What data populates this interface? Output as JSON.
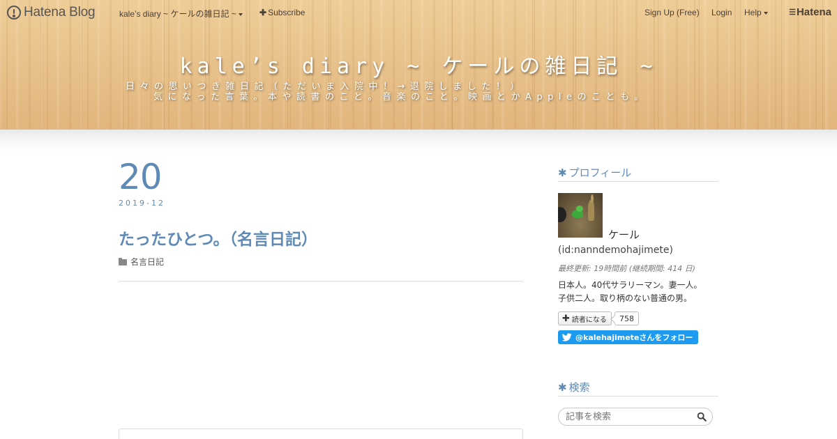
{
  "topbar": {
    "logo_text": "Hatena Blog",
    "blog_menu": "kale’s diary ~ ケールの雑日記 ~",
    "subscribe": "Subscribe",
    "signup": "Sign Up (Free)",
    "login": "Login",
    "help": "Help",
    "hatena": "Hatena"
  },
  "blog": {
    "title": "kale’s diary ~ ケールの雑日記 ~",
    "description_line1": "日々の思いつき雑日記（ただいま入院中！→退院しました！）",
    "description_line2": "気になった言葉。本や読書のこと。音楽のこと。映画とかAppleのことも。"
  },
  "entry": {
    "day": "20",
    "year_month": "2019-12",
    "title": "たったひとつ。（名言日記）",
    "category": "名言日記"
  },
  "sidebar": {
    "profile": {
      "heading": "プロフィール",
      "name": "ケール",
      "id": "(id:nanndemohajimete)",
      "last_updated": "最終更新: 19時間前 (継続期間: 414 日)",
      "bio_line1": "日本人。40代サラリーマン。妻一人。",
      "bio_line2": "子供二人。取り柄のない普通の男。",
      "reader_button": "読者になる",
      "reader_count": "758",
      "twitter_button": "@kalehajimeteさんをフォロー"
    },
    "search": {
      "heading": "検索",
      "placeholder": "記事を検索"
    }
  },
  "colors": {
    "accent": "#5f8ab5",
    "twitter": "#1d9bf0",
    "header_wood": "#e6bd86"
  },
  "icons": {
    "logo": "hatena-blog-logo-icon",
    "subscribe": "plus-icon",
    "category": "folder-icon",
    "twitter": "twitter-bird-icon",
    "search": "magnifier-icon"
  }
}
